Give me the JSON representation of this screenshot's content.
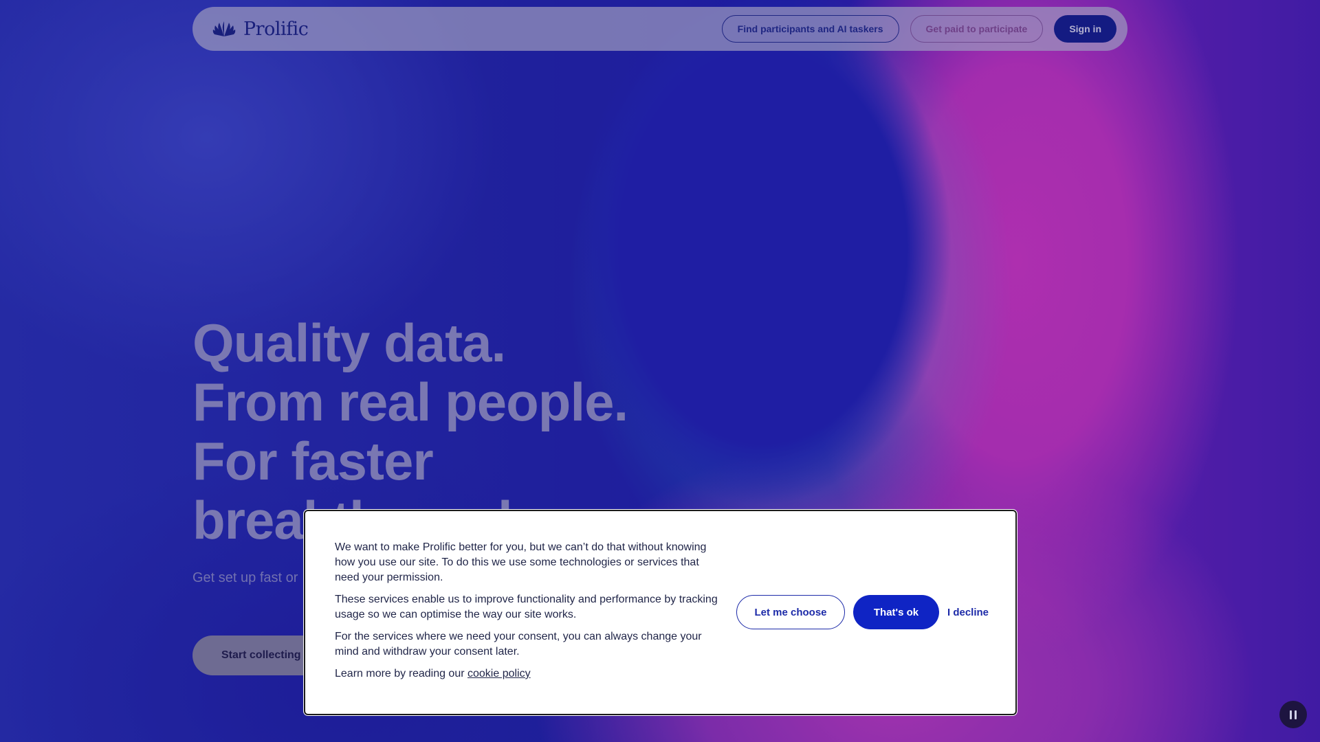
{
  "header": {
    "logo_text": "Prolific",
    "nav": {
      "find_label": "Find participants and AI taskers",
      "paid_label": "Get paid to participate",
      "signin_label": "Sign in"
    }
  },
  "hero": {
    "title_lines": [
      "Quality data.",
      "From real people.",
      "For faster",
      "breakthroughs."
    ],
    "subtitle": "Get set up fast or",
    "cta_label": "Start collecting"
  },
  "cookie_modal": {
    "paragraph_1": "We want to make Prolific better for you, but we can’t do that without knowing how you use our site. To do this we use some technologies or services that need your permission.",
    "paragraph_2": "These services enable us to improve functionality and performance by tracking usage so we can optimise the way our site works.",
    "paragraph_3": "For the services where we need your consent, you can always change your mind and withdraw your consent later.",
    "learn_more_prefix": "Learn more by reading our ",
    "learn_more_link": "cookie policy",
    "buttons": {
      "choose_label": "Let me choose",
      "ok_label": "That's ok",
      "decline_label": "I decline"
    }
  },
  "icons": {
    "logo": "prolific-fan-icon",
    "pause": "pause-icon"
  },
  "colors": {
    "brand_navy": "#0d1b8a",
    "primary_button": "#0f24c4"
  }
}
